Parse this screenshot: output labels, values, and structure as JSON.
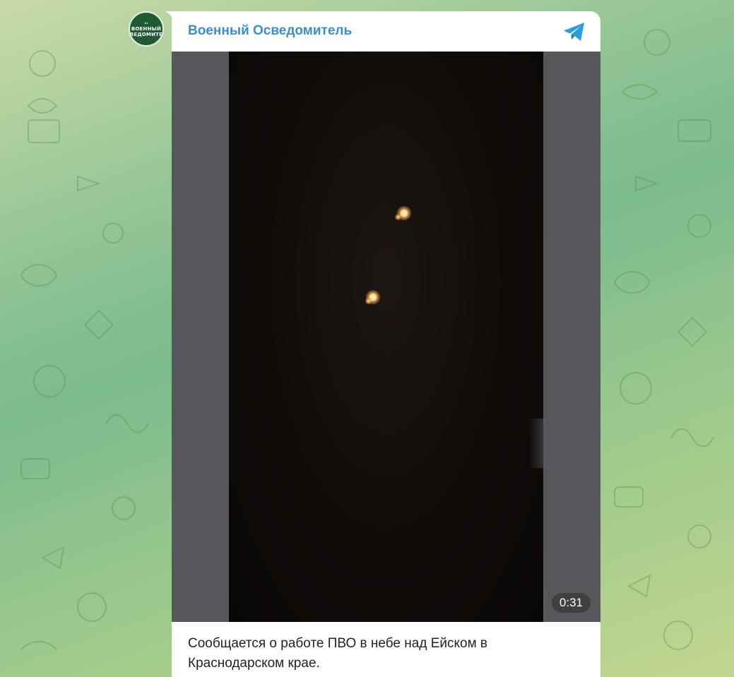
{
  "post": {
    "channel_name": "Военный Осведомитель",
    "avatar_lines": [
      "Военный",
      "осведомитель"
    ],
    "video_duration": "0:31",
    "caption": "Сообщается о работе ПВО в небе над Ейском в\nКраснодарском крае."
  },
  "icons": {
    "share": "telegram-plane-icon"
  },
  "colors": {
    "channel_name": "#3a8dd0",
    "telegram_blue": "#2a9ee0",
    "avatar_bg": "#1f5a33",
    "video_side": "#56575a",
    "video_frame": "#100c0a"
  }
}
